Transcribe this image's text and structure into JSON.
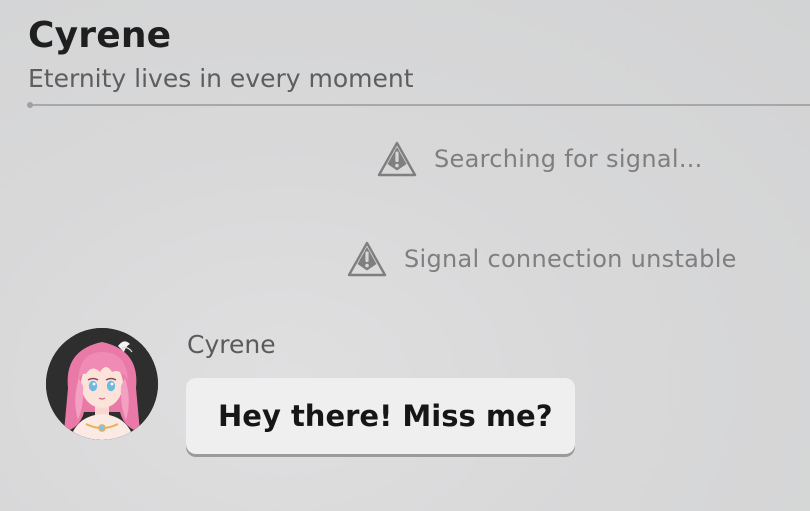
{
  "header": {
    "contact_name": "Cyrene",
    "tagline": "Eternity lives in every moment"
  },
  "system_messages": [
    {
      "icon": "signal-warning-icon",
      "text": "Searching for signal..."
    },
    {
      "icon": "signal-warning-icon",
      "text": "Signal connection unstable"
    }
  ],
  "messages": [
    {
      "sender": "Cyrene",
      "avatar": "cyrene-avatar",
      "text": "Hey there! Miss me?"
    }
  ],
  "colors": {
    "background": "#d6d6d7",
    "bubble": "#efefef",
    "system_text": "#7f7f7f",
    "avatar_bg": "#2e2e2e",
    "hair_pink": "#f08cb4"
  }
}
